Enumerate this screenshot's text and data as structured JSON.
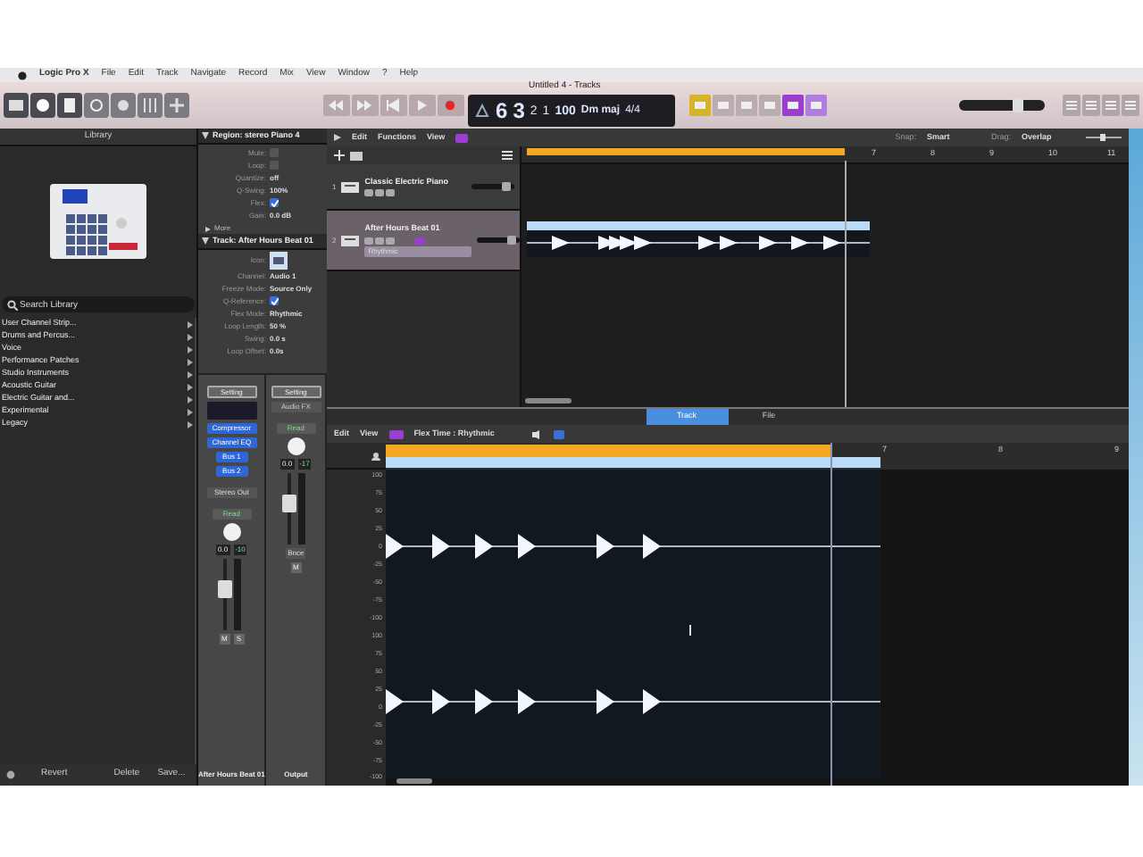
{
  "menu_bar": {
    "items": [
      "Logic Pro X",
      "File",
      "Edit",
      "Track",
      "Navigate",
      "Record",
      "Mix",
      "View",
      "Window",
      "?",
      "Help"
    ]
  },
  "window": {
    "title": "Untitled 4 - Tracks"
  },
  "lcd": {
    "bar": "6",
    "beat": "3",
    "division": "2",
    "tick": "1",
    "tempo": "100",
    "key": "Dm maj",
    "signature": "4/4"
  },
  "master_volume": {
    "level": 0.72
  },
  "library": {
    "title": "Library",
    "search": {
      "placeholder": "Search Library"
    },
    "items": [
      "User Channel Strip...",
      "Drums and Percus...",
      "Voice",
      "Performance Patches",
      "Studio Instruments",
      "Acoustic Guitar",
      "Electric Guitar and...",
      "Experimental",
      "Legacy"
    ],
    "footer": [
      "Revert",
      "Delete",
      "Save..."
    ]
  },
  "inspector": {
    "region": {
      "title": "Region: stereo Piano 4",
      "expanded": true,
      "rows": [
        {
          "kind": "check",
          "label": "Mute:",
          "checked": false
        },
        {
          "kind": "check",
          "label": "Loop:",
          "checked": false
        },
        {
          "kind": "text",
          "label": "Quantize:",
          "value": "off"
        },
        {
          "kind": "text",
          "label": "Q-Swing:",
          "value": "100%"
        },
        {
          "kind": "check",
          "label": "Flex:",
          "checked": true
        },
        {
          "kind": "text",
          "label": "Gain:",
          "value": "0.0 dB"
        }
      ],
      "more": "More"
    },
    "track": {
      "title": "Track: After Hours Beat 01",
      "expanded": true,
      "rows": [
        {
          "kind": "icon",
          "label": "Icon:"
        },
        {
          "kind": "text",
          "label": "Channel:",
          "value": "Audio 1"
        },
        {
          "kind": "text",
          "label": "Freeze Mode:",
          "value": "Source Only"
        },
        {
          "kind": "check",
          "label": "Q-Reference:",
          "checked": true
        },
        {
          "kind": "text",
          "label": "Flex Mode:",
          "value": "Rhythmic"
        },
        {
          "kind": "text",
          "label": "Loop Length:",
          "value": "50 %"
        },
        {
          "kind": "text",
          "label": "Swing:",
          "value": "0.0 s"
        },
        {
          "kind": "text",
          "label": "Loop Offset:",
          "value": "0.0s"
        }
      ]
    }
  },
  "channel_strips": [
    {
      "setting": "Setting",
      "inserts": [
        "Compressor",
        "Channel EQ"
      ],
      "sends": [
        "Bus 1",
        "Bus 2"
      ],
      "output": "Stereo Out",
      "automation": "Read",
      "values": [
        "0.0",
        "-10"
      ],
      "level": 0.6,
      "buttons": [
        "M",
        "S"
      ],
      "name": "After Hours Beat 01"
    },
    {
      "setting": "Setting",
      "inserts": [
        "Audio FX"
      ],
      "automation": "Read",
      "values": [
        "0.0",
        "-17"
      ],
      "level": 0.6,
      "buttons": [
        "M"
      ],
      "bounce": "Bnce",
      "name": "Output"
    }
  ],
  "tracks_area": {
    "menus": [
      "Edit",
      "Functions",
      "View"
    ],
    "snap_label": "Snap:",
    "snap": "Smart",
    "drag_label": "Drag:",
    "drag": "Overlap",
    "ruler": [
      "7",
      "8",
      "9",
      "10",
      "11"
    ],
    "tracks": [
      {
        "number": "1",
        "name": "Classic Electric Piano",
        "selected": false
      },
      {
        "number": "2",
        "name": "After Hours Beat 01",
        "selected": true,
        "flex_mode": "Rhythmic"
      }
    ]
  },
  "editor": {
    "tabs": [
      {
        "label": "Track",
        "selected": true
      },
      {
        "label": "File",
        "selected": false
      }
    ],
    "menus": [
      "Edit",
      "View"
    ],
    "flex": "Flex Time : Rhythmic",
    "ruler": [
      "7",
      "8",
      "9"
    ],
    "axis": [
      "100",
      "75",
      "50",
      "25",
      "0",
      "-25",
      "-50",
      "-75",
      "-100",
      "100",
      "75",
      "50",
      "25",
      "0",
      "-25",
      "-50",
      "-75",
      "-100"
    ]
  }
}
